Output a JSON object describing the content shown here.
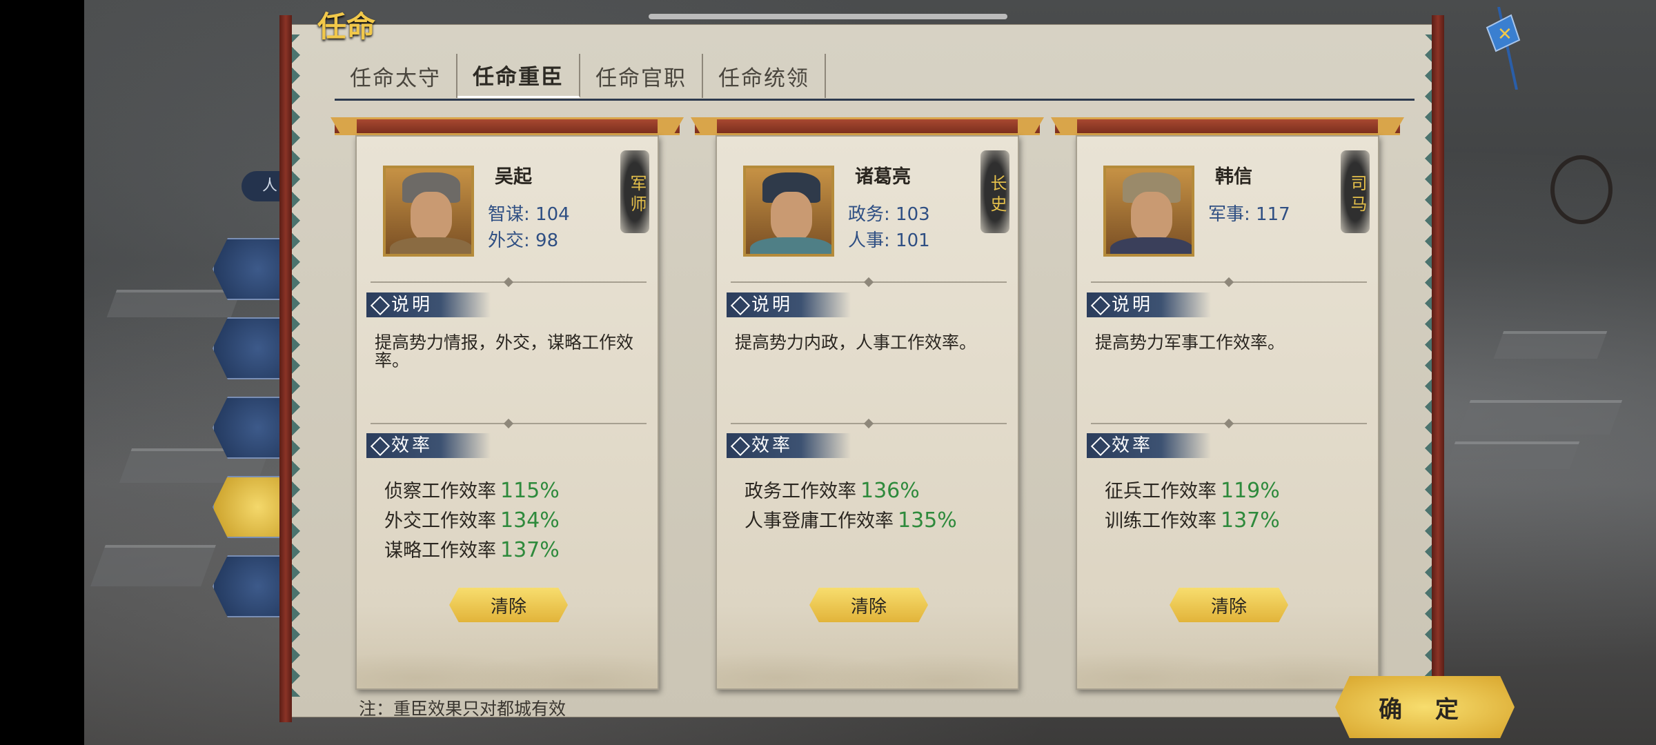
{
  "panel": {
    "title": "任命",
    "side_label": "人",
    "note": "注：重臣效果只对都城有效",
    "confirm_label": "确 定"
  },
  "tabs": [
    {
      "label": "任命太守",
      "active": false
    },
    {
      "label": "任命重臣",
      "active": true
    },
    {
      "label": "任命官职",
      "active": false
    },
    {
      "label": "任命统领",
      "active": false
    }
  ],
  "cards": [
    {
      "name": "吴起",
      "role": "军师",
      "stats": [
        "智谋: 104",
        "外交: 98"
      ],
      "desc_title": "说明",
      "desc": "提高势力情报，外交，谋略工作效率。",
      "eff_title": "效率",
      "effects": [
        {
          "label": "侦察工作效率",
          "value": "115%"
        },
        {
          "label": "外交工作效率",
          "value": "134%"
        },
        {
          "label": "谋略工作效率",
          "value": "137%"
        }
      ],
      "clear_label": "清除"
    },
    {
      "name": "诸葛亮",
      "role": "长史",
      "stats": [
        "政务: 103",
        "人事: 101"
      ],
      "desc_title": "说明",
      "desc": "提高势力内政，人事工作效率。",
      "eff_title": "效率",
      "effects": [
        {
          "label": "政务工作效率",
          "value": "136%"
        },
        {
          "label": "人事登庸工作效率",
          "value": "135%"
        }
      ],
      "clear_label": "清除"
    },
    {
      "name": "韩信",
      "role": "司马",
      "stats": [
        "军事: 117"
      ],
      "desc_title": "说明",
      "desc": "提高势力军事工作效率。",
      "eff_title": "效率",
      "effects": [
        {
          "label": "征兵工作效率",
          "value": "119%"
        },
        {
          "label": "训练工作效率",
          "value": "137%"
        }
      ],
      "clear_label": "清除"
    }
  ],
  "colors": {
    "accent_gold": "#f1c84a",
    "stat_blue": "#2f4f83",
    "efficiency_green": "#2e8a3c",
    "section_navy": "#2b3d5c"
  }
}
